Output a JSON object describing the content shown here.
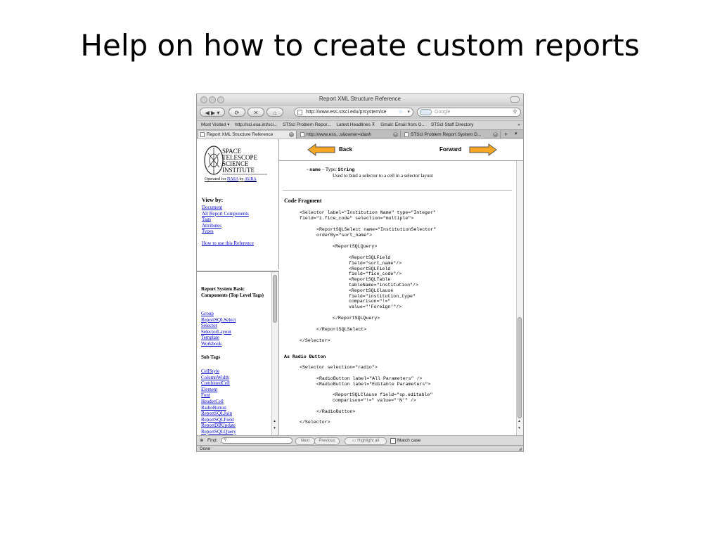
{
  "slide": {
    "title": "Help on how to create custom reports"
  },
  "window": {
    "title": "Report XML Structure Reference"
  },
  "toolbar": {
    "url": "http://www.ess.stsci.edu/prsystem/se",
    "search_placeholder": "Google"
  },
  "bookmarks": [
    "Most Visited ▾",
    "http://sci.esa.int/sci...",
    "STScI Problem Repor...",
    "Latest Headlines ⊼",
    "Gmail: Email from G...",
    "STScI Staff Directory",
    "»"
  ],
  "tabs": [
    "Report XML Structure Reference",
    "http://www.ess...s&owner=idash",
    "STScI Problem Report System D..."
  ],
  "logo": {
    "lines": [
      "SPACE",
      "TELESCOPE",
      "SCIENCE",
      "INSTITUTE"
    ],
    "operated_prefix": "Operated for ",
    "nasa": "NASA",
    "by": " by ",
    "aura": "AURA"
  },
  "sidebar": {
    "view_by": "View by:",
    "view_links": [
      "Document",
      "All Report Components",
      "Tags",
      "Attributes",
      "Types"
    ],
    "how_to_use": "How to use this Reference",
    "basic_heading": "Report System Basic Components (Top Level Tags)",
    "basic_links": [
      "Group",
      "ReportSQLSelect",
      "Selector",
      "SelectorLayout",
      "Template",
      "Workbook"
    ],
    "sub_heading": "Sub Tags",
    "sub_links": [
      "CellStyle",
      "ColumnWidth",
      "CombinedCell",
      "Element",
      "Font",
      "HeaderCell",
      "RadioButton",
      "ReportSQLJoin",
      "ReportSQLField",
      "ReportDBUpdate",
      "ReportSQLQuery"
    ]
  },
  "nav": {
    "back": "Back",
    "forward": "Forward"
  },
  "main": {
    "attr_name": "name",
    "attr_dash": " – Type: ",
    "attr_type": "String",
    "attr_desc": "Used to bind a selector to a cell in a selector layout",
    "code_fragment_heading": "Code Fragment",
    "code_1": "<Selector label=\"Institution Name\" type=\"Integer\"\nfield=\"i.fice_code\" selection=\"multiple\">",
    "code_2": "<ReportSQLSelect name=\"InstitutionSelector\"\norderBy=\"sort_name\">",
    "code_3": "<ReportSQLQuery>",
    "code_4": "<ReportSQLField\nfield=\"sort_name\"/>\n<ReportSQLField\nfield=\"fice_code\"/>\n<ReportSQLTable\ntableName=\"institution\"/>\n<ReportSQLClause\nfield=\"institution_type\"\ncomparison=\"!=\"\nvalue=\"'Foreign'\"/>",
    "code_5": "</ReportSQLQuery>",
    "code_6": "</ReportSQLSelect>",
    "code_7": "</Selector>",
    "radio_heading": "As Radio Button",
    "code_8": "<Selector selection=\"radio\">",
    "code_9": "<RadioButton label=\"All Parameters\" />\n<RadioButton label=\"Editable Parameters\">",
    "code_10": "<ReportSQLClause field=\"sp.editable\"\ncomparison=\"!=\" value=\"'N'\" />",
    "code_11": "</RadioButton>",
    "code_12": "</Selector>"
  },
  "find_bar": {
    "label": "Find:",
    "next": "Next",
    "previous": "Previous",
    "highlight": "Highlight all",
    "match_case": "Match case"
  },
  "status": "Done"
}
